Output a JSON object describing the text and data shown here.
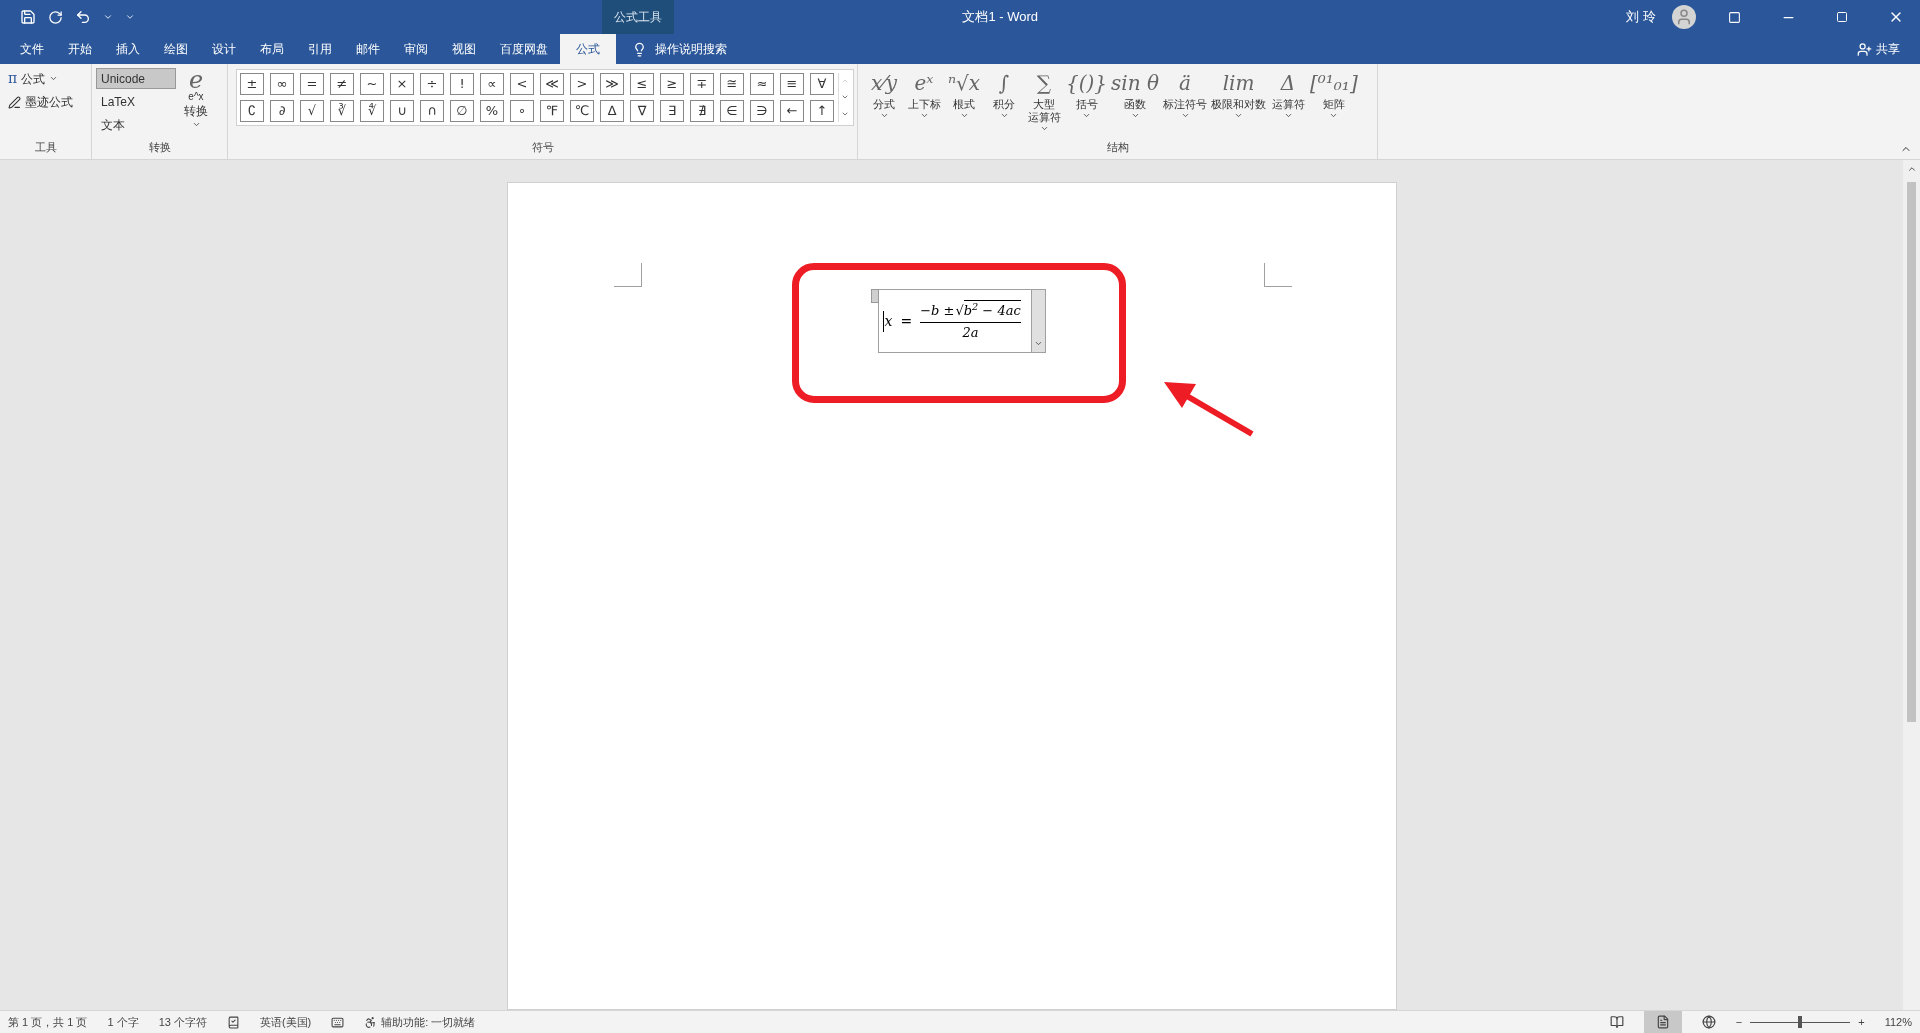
{
  "window": {
    "title": "文档1  -  Word",
    "context_label": "公式工具",
    "user": "刘 玲",
    "share": "共享"
  },
  "tabs": [
    {
      "label": "文件",
      "selected": false
    },
    {
      "label": "开始",
      "selected": false
    },
    {
      "label": "插入",
      "selected": false
    },
    {
      "label": "绘图",
      "selected": false
    },
    {
      "label": "设计",
      "selected": false
    },
    {
      "label": "布局",
      "selected": false
    },
    {
      "label": "引用",
      "selected": false
    },
    {
      "label": "邮件",
      "selected": false
    },
    {
      "label": "审阅",
      "selected": false
    },
    {
      "label": "视图",
      "selected": false
    },
    {
      "label": "百度网盘",
      "selected": false
    },
    {
      "label": "公式",
      "selected": true
    }
  ],
  "tell_me": "操作说明搜索",
  "tools_group": {
    "title": "工具",
    "pi": "π",
    "equation": "公式",
    "ink": "墨迹公式"
  },
  "convert_group": {
    "title": "转换",
    "options": [
      {
        "label": "Unicode",
        "selected": true
      },
      {
        "label": "LaTeX",
        "selected": false
      },
      {
        "label": "文本",
        "selected": false
      }
    ],
    "convert": "转换",
    "convert_glyph": "e",
    "convert_sub": "e^x"
  },
  "symbols_group": {
    "title": "符号",
    "rows": [
      [
        "±",
        "∞",
        "=",
        "≠",
        "~",
        "×",
        "÷",
        "!",
        "∝",
        "<",
        "≪",
        ">",
        "≫",
        "≤",
        "≥",
        "∓",
        "≅",
        "≈",
        "≡",
        "∀"
      ],
      [
        "∁",
        "∂",
        "√",
        "∛",
        "∜",
        "∪",
        "∩",
        "∅",
        "%",
        "∘",
        "℉",
        "℃",
        "∆",
        "∇",
        "∃",
        "∄",
        "∈",
        "∋",
        "←",
        "↑"
      ]
    ]
  },
  "structures_group": {
    "title": "结构",
    "items": [
      {
        "label": "分式",
        "glyph": "x⁄y"
      },
      {
        "label": "上下标",
        "glyph": "eˣ"
      },
      {
        "label": "根式",
        "glyph": "ⁿ√x"
      },
      {
        "label": "积分",
        "glyph": "∫"
      },
      {
        "label": "大型",
        "label_2": "运算符",
        "glyph": "∑"
      },
      {
        "label": "括号",
        "glyph": "{()}"
      },
      {
        "label": "函数",
        "glyph": "sin θ"
      },
      {
        "label": "标注符号",
        "glyph": "ä"
      },
      {
        "label": "极限和对数",
        "glyph": "lim"
      },
      {
        "label": "运算符",
        "glyph": "Δ"
      },
      {
        "label": "矩阵",
        "glyph": "[⁰¹₀₁]"
      }
    ]
  },
  "equation": {
    "lhs": "x",
    "equals": "=",
    "numerator": "−b ±",
    "radical": "√",
    "radicand": "b$^{2}$ − 4ac",
    "denominator": "2a"
  },
  "status_bar": {
    "page": "第 1 页，共 1 页",
    "words": "1 个字",
    "chars": "13 个字符",
    "language": "英语(美国)",
    "accessibility": "辅助功能: 一切就绪",
    "zoom": "112%"
  },
  "zoom_slider": {
    "level": 0.5,
    "minus": "−",
    "plus": "+"
  }
}
